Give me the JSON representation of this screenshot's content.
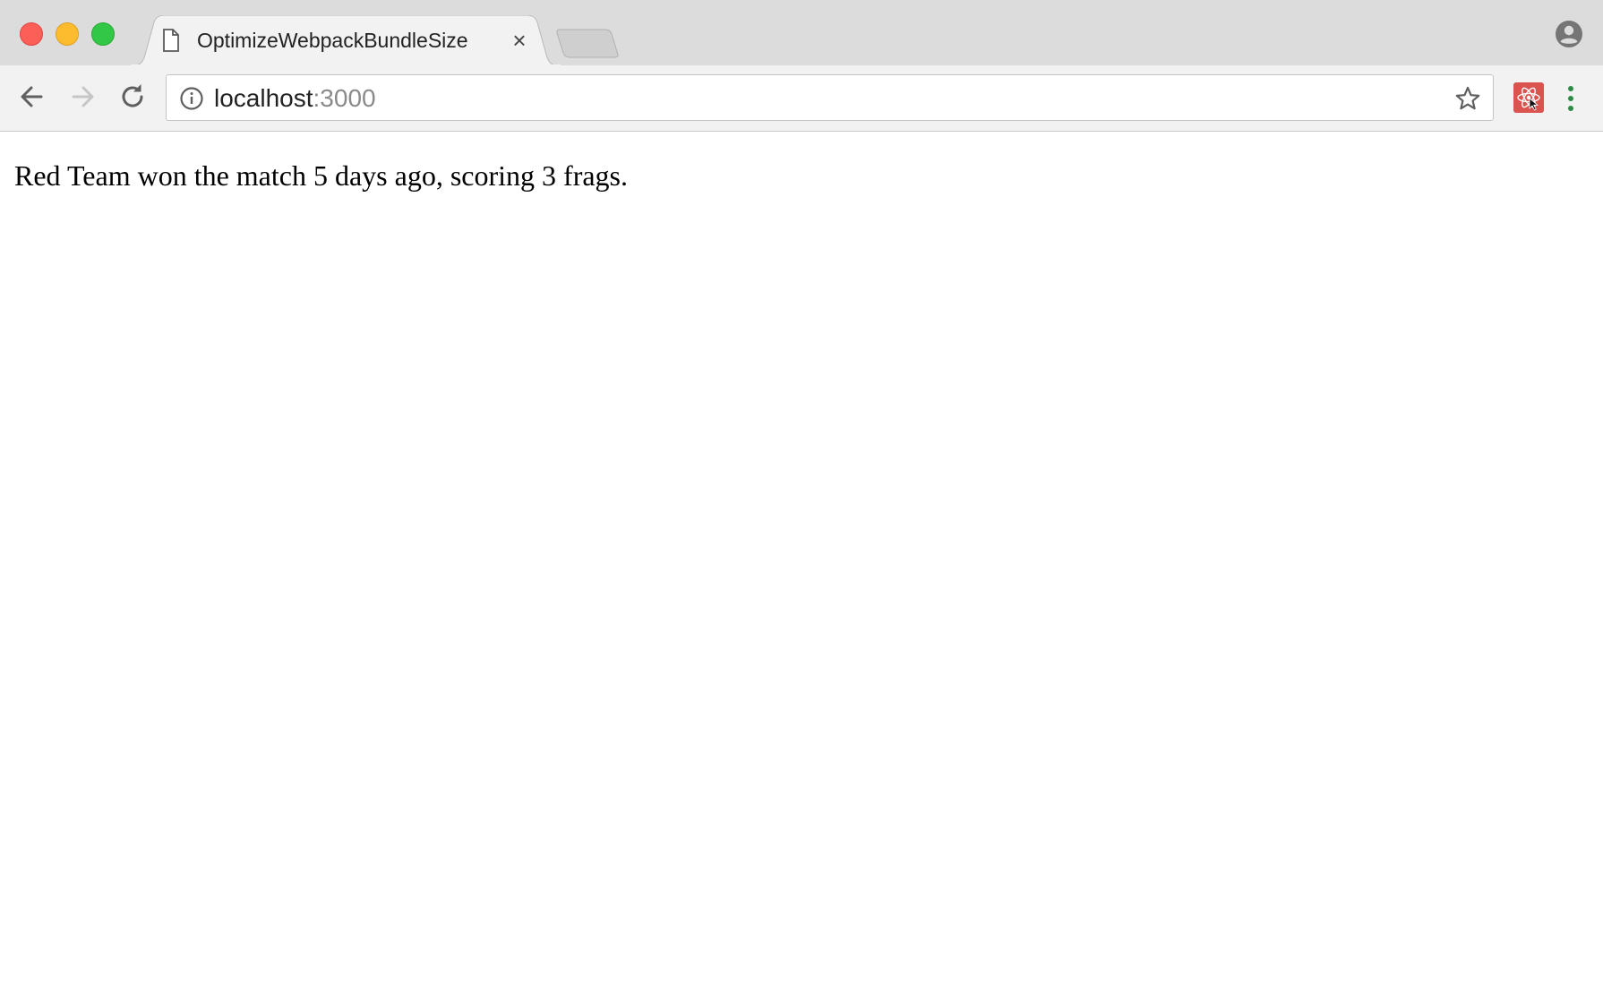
{
  "tab": {
    "title": "OptimizeWebpackBundleSize",
    "close_glyph": "×",
    "icon": "document-icon"
  },
  "address_bar": {
    "host": "localhost",
    "port": ":3000",
    "security_icon": "info-icon"
  },
  "toolbar": {
    "back_icon": "arrow-left-icon",
    "forward_icon": "arrow-right-icon",
    "reload_icon": "reload-icon",
    "bookmark_icon": "star-icon",
    "extension_icon": "react-devtools-icon",
    "menu_icon": "more-vertical-icon"
  },
  "page": {
    "message": "Red Team won the match 5 days ago, scoring 3 frags."
  },
  "colors": {
    "close": "#fc5f57",
    "minimize": "#fdbc2e",
    "maximize": "#33c748",
    "extension": "#d9534f",
    "menu_dots": "#2e8b45"
  }
}
